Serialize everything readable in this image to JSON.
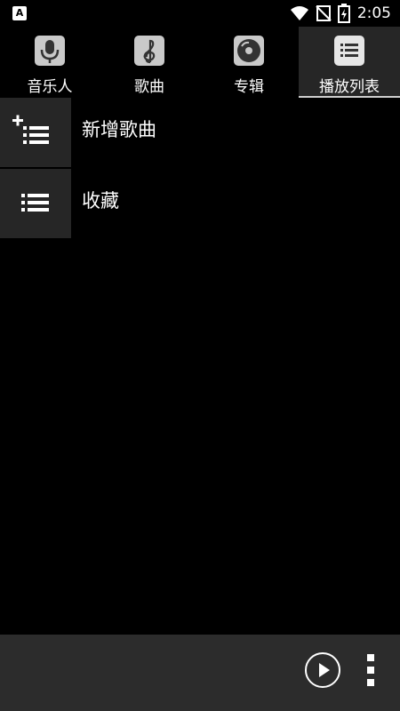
{
  "statusbar": {
    "time": "2:05",
    "left_icon": "A"
  },
  "tabs": [
    {
      "label": "音乐人",
      "icon": "microphone-icon"
    },
    {
      "label": "歌曲",
      "icon": "treble-clef-icon"
    },
    {
      "label": "专辑",
      "icon": "disc-icon"
    },
    {
      "label": "播放列表",
      "icon": "playlist-icon",
      "active": true
    }
  ],
  "list": [
    {
      "label": "新增歌曲",
      "icon": "add-playlist-icon"
    },
    {
      "label": "收藏",
      "icon": "playlist-icon"
    }
  ],
  "colors": {
    "background": "#000000",
    "active_tab": "#262626",
    "bottombar": "#2c2c2c",
    "icon_box": "#c9c9c9"
  }
}
